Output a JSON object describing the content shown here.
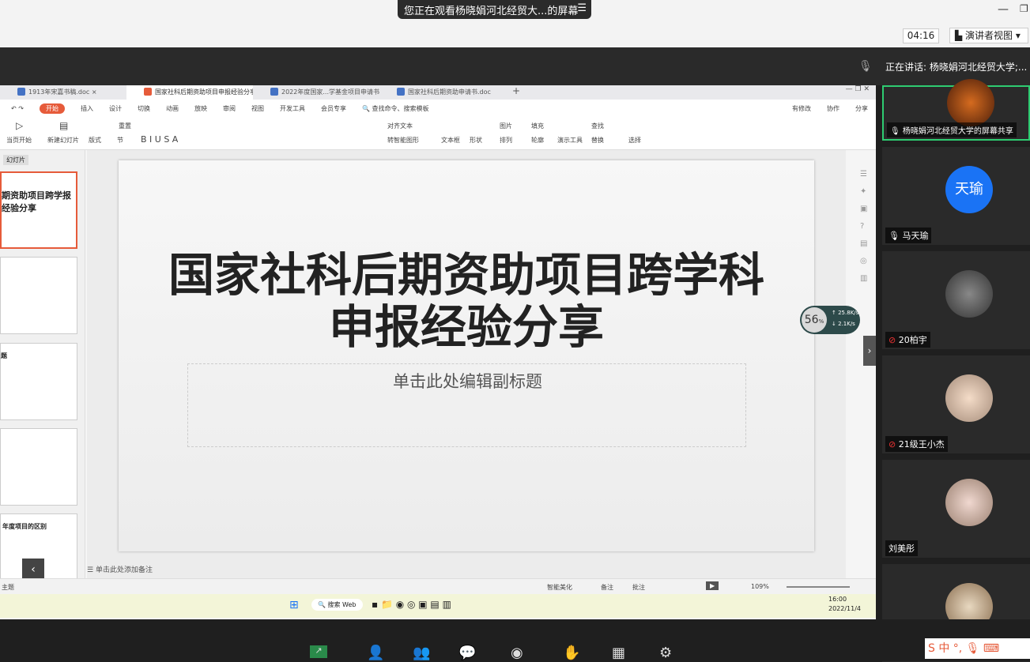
{
  "meeting": {
    "banner": "您正在观看杨晓娟河北经贸大...的屏幕",
    "timer": "04:16",
    "presenter_view": "演讲者视图",
    "speaking": "正在讲话: 杨晓娟河北经贸大学;..."
  },
  "tabs": [
    {
      "label": "1913年宋嘉书稿.doc"
    },
    {
      "label": "国家社科后期资助项目申报经验分享"
    },
    {
      "label": "2022年度国家...学基金项目申请书"
    },
    {
      "label": "国家社科后期资助申请书.doc"
    }
  ],
  "menus": [
    "开始",
    "插入",
    "设计",
    "切换",
    "动画",
    "放映",
    "审阅",
    "视图",
    "开发工具",
    "会员专享",
    "查找命令、搜索模板"
  ],
  "menu_right": [
    "有修改",
    "协作",
    "分享"
  ],
  "ribbon": {
    "from_current": "当页开始",
    "new_slide": "新建幻灯片",
    "layout": "版式",
    "section": "节",
    "reset": "重置",
    "textbox": "文本框",
    "shapes": "形状",
    "picture": "图片",
    "arrange": "排列",
    "presentation_tools": "演示工具",
    "find": "查找",
    "replace": "替换",
    "select": "选择",
    "align_text": "对齐文本",
    "smart_shape": "转智能图形",
    "fill": "填充",
    "outline": "轮廓"
  },
  "sidebar": {
    "tab_label": "幻灯片",
    "thumb1": "期资助项目跨学报经验分享",
    "thumb3_title": "题",
    "thumb5_title": "年度项目的区别"
  },
  "slide": {
    "title": "国家社科后期资助项目跨学科申报经验分享",
    "subtitle_placeholder": "单击此处编辑副标题"
  },
  "gauge": {
    "percent": "56",
    "unit": "%",
    "upload": "25.8",
    "download": "2.1",
    "speed_unit": "K/s"
  },
  "notes_placeholder": "单击此处添加备注",
  "status": {
    "theme": "主题",
    "beautify": "智能美化",
    "notes": "备注",
    "comments": "批注",
    "zoom": "109%"
  },
  "taskbar": {
    "search": "搜索 Web",
    "time": "16:00",
    "date": "2022/11/4"
  },
  "participants": [
    {
      "name": "杨晓娟河北经贸大学的屏幕共享",
      "mic": "on"
    },
    {
      "name": "马天瑜",
      "avatar_text": "天瑜",
      "avatar_color": "#1a73f5",
      "mic": "on"
    },
    {
      "name": "20柏宇",
      "mic": "muted"
    },
    {
      "name": "21级王小杰",
      "mic": "muted"
    },
    {
      "name": "刘美彤",
      "mic": "none"
    },
    {
      "name": "",
      "mic": "none"
    }
  ],
  "colors": {
    "accent": "#e65b3a",
    "wps_blue": "#4472c4",
    "avatar_blue": "#1a73f5"
  }
}
